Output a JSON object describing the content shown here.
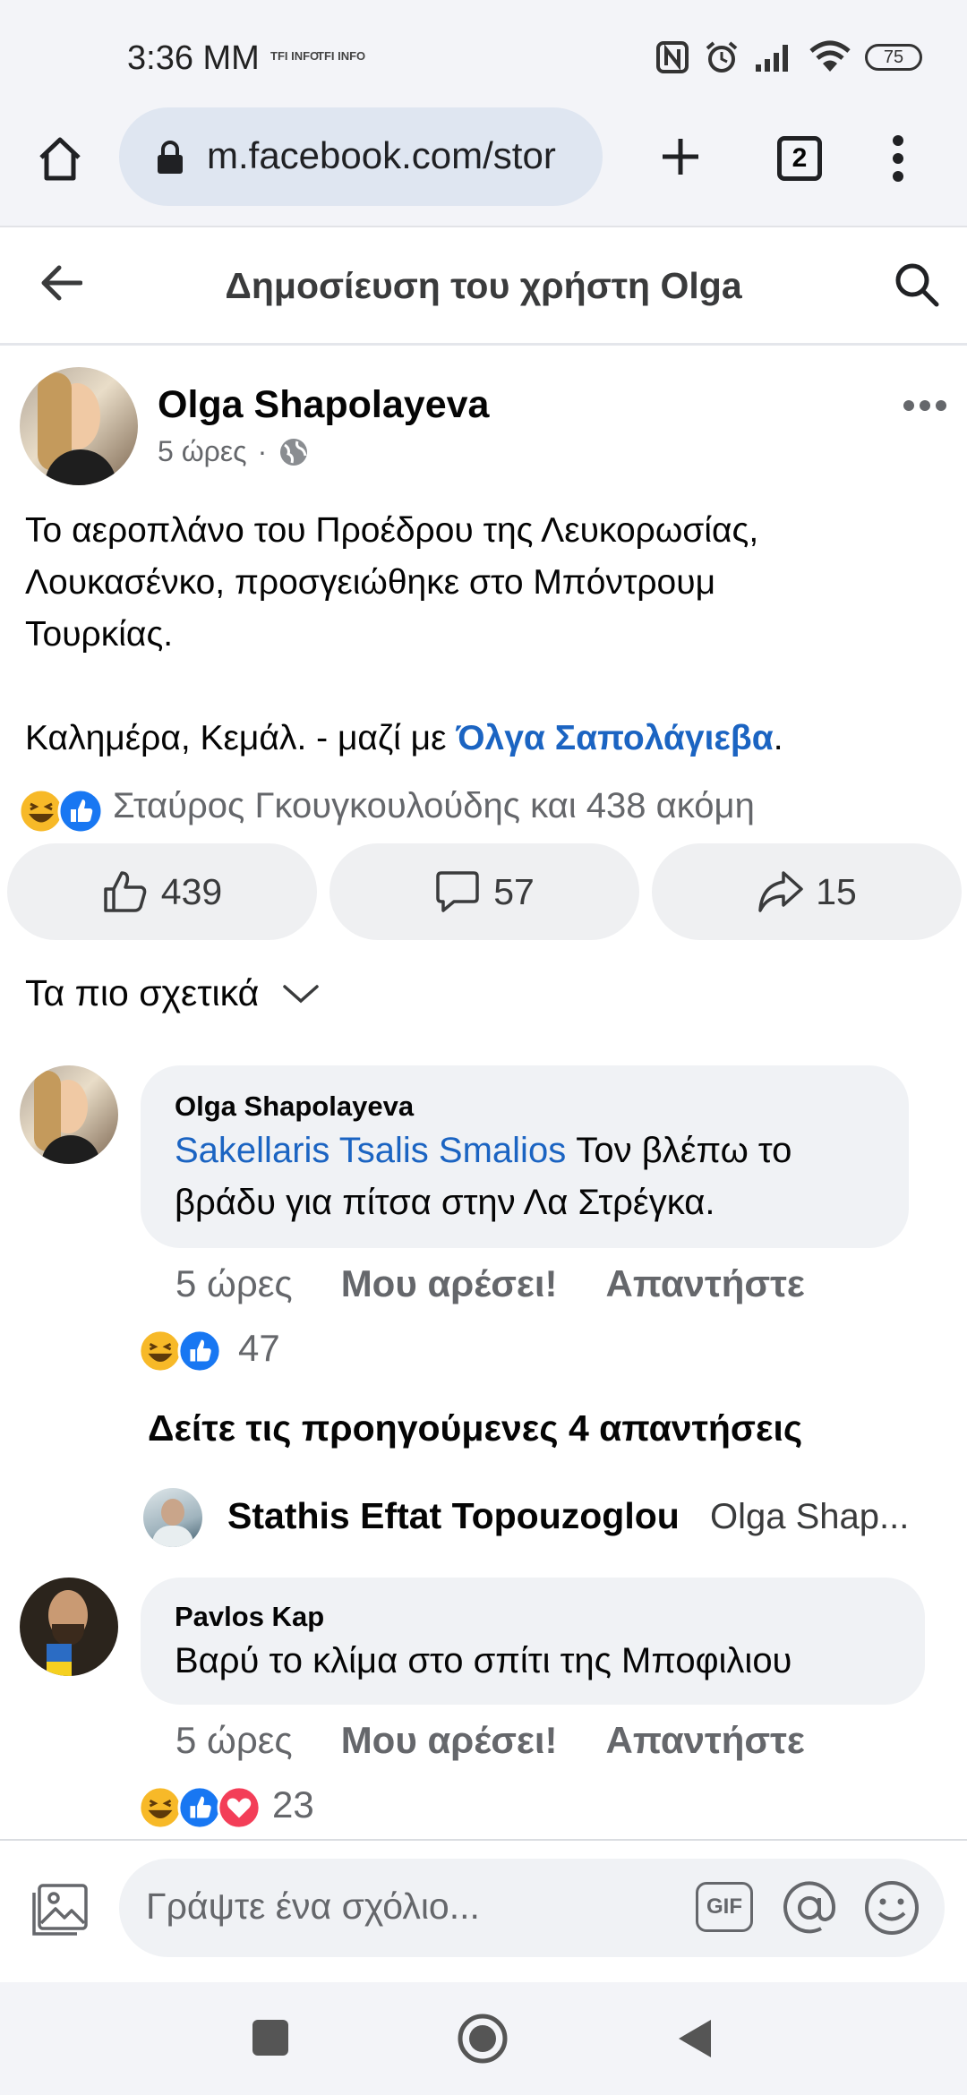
{
  "status": {
    "time": "3:36 MM",
    "mini1": "TFI INFO",
    "mini2": "TFI INFO",
    "battery": "75"
  },
  "browser": {
    "url": "m.facebook.com/stor",
    "tabs_count": "2"
  },
  "header": {
    "title": "Δημοσίευση του χρήστη Olga"
  },
  "post": {
    "author": "Olga Shapolayeva",
    "time": "5 ώρες",
    "dot": "·",
    "text_line1": "Το αεροπλάνο του Προέδρου της Λευκορωσίας,",
    "text_line2": "Λουκασένκο, προσγειώθηκε στο Μπόντρουμ",
    "text_line3": "Τουρκίας.",
    "text_line4_prefix": "Καλημέρα, Κεμάλ. - μαζί με ",
    "text_line4_link": "Όλγα Σαπολάγιεβα",
    "text_line4_suffix": ".",
    "reactions_summary": "Σταύρος Γκουγκουλούδης και 438 ακόμη",
    "likes": "439",
    "comments": "57",
    "shares": "15"
  },
  "sort": {
    "label": "Τα πιο σχετικά"
  },
  "comments": [
    {
      "author": "Olga Shapolayeva",
      "mention": "Sakellaris Tsalis Smalios",
      "text_rest": " Τον βλέπω το",
      "text_line2": "βράδυ για πίτσα στην Λα Στρέγκα.",
      "time": "5 ώρες",
      "like": "Μου αρέσει!",
      "reply": "Απαντήστε",
      "reactions": "47"
    },
    {
      "author": "Pavlos Kap",
      "text": "Βαρύ το κλίμα στο σπίτι της Μποφιλιου",
      "time": "5 ώρες",
      "like": "Μου αρέσει!",
      "reply": "Απαντήστε",
      "reactions": "23"
    }
  ],
  "replies": {
    "see_previous": "Δείτε τις προηγούμενες 4 απαντήσεις",
    "preview_author": "Stathis Eftat Topouzoglou",
    "preview_text": "Olga Shap..."
  },
  "composer": {
    "placeholder": "Γράψτε ένα σχόλιο...",
    "gif": "GIF"
  },
  "colors": {
    "link": "#1b64c2",
    "like_blue": "#1877f2",
    "haha_yellow": "#f7b928",
    "love_red": "#f33e58"
  }
}
